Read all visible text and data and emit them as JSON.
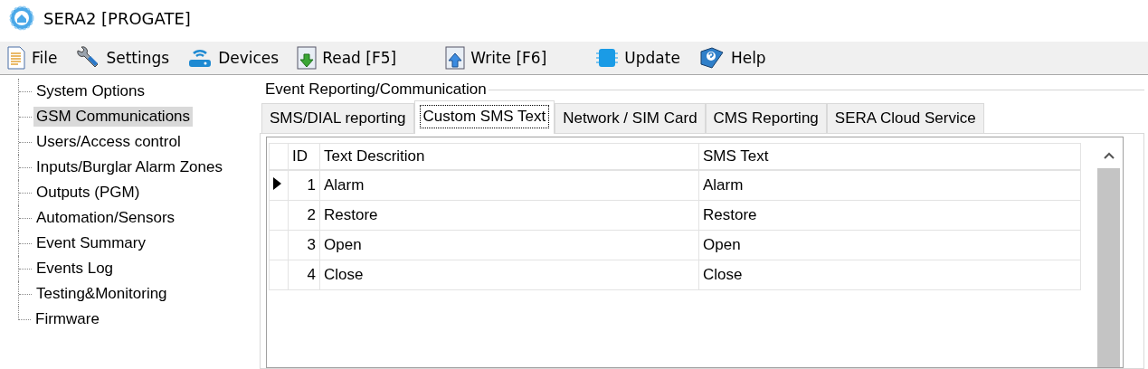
{
  "window": {
    "title": "SERA2 [PROGATE]"
  },
  "toolbar": [
    {
      "label": "File",
      "kind": "file"
    },
    {
      "label": "Settings",
      "kind": "settings"
    },
    {
      "label": "Devices",
      "kind": "devices"
    },
    {
      "label": "Read [F5]",
      "kind": "read"
    },
    {
      "label": "Write [F6]",
      "kind": "write"
    },
    {
      "label": "Update",
      "kind": "update"
    },
    {
      "label": "Help",
      "kind": "help"
    }
  ],
  "tree": {
    "items": [
      {
        "label": "System Options",
        "selected": false
      },
      {
        "label": "GSM Communications",
        "selected": true
      },
      {
        "label": "Users/Access control",
        "selected": false
      },
      {
        "label": "Inputs/Burglar Alarm Zones",
        "selected": false
      },
      {
        "label": "Outputs (PGM)",
        "selected": false
      },
      {
        "label": "Automation/Sensors",
        "selected": false
      },
      {
        "label": "Event Summary",
        "selected": false
      },
      {
        "label": "Events Log",
        "selected": false
      },
      {
        "label": "Testing&Monitoring",
        "selected": false
      },
      {
        "label": "Firmware",
        "selected": false
      }
    ]
  },
  "group": {
    "title": "Event Reporting/Communication"
  },
  "tabs": [
    {
      "label": "SMS/DIAL reporting",
      "selected": false
    },
    {
      "label": "Custom SMS Text",
      "selected": true
    },
    {
      "label": "Network / SIM Card",
      "selected": false
    },
    {
      "label": "CMS Reporting",
      "selected": false
    },
    {
      "label": "SERA Cloud Service",
      "selected": false
    }
  ],
  "grid": {
    "columns": [
      "ID",
      "Text Descrition",
      "SMS Text"
    ],
    "rows": [
      {
        "id": "1",
        "description": "Alarm",
        "sms_text": "Alarm",
        "selected": true
      },
      {
        "id": "2",
        "description": "Restore",
        "sms_text": "Restore",
        "selected": false
      },
      {
        "id": "3",
        "description": "Open",
        "sms_text": "Open",
        "selected": false
      },
      {
        "id": "4",
        "description": "Close",
        "sms_text": "Close",
        "selected": false
      }
    ]
  }
}
